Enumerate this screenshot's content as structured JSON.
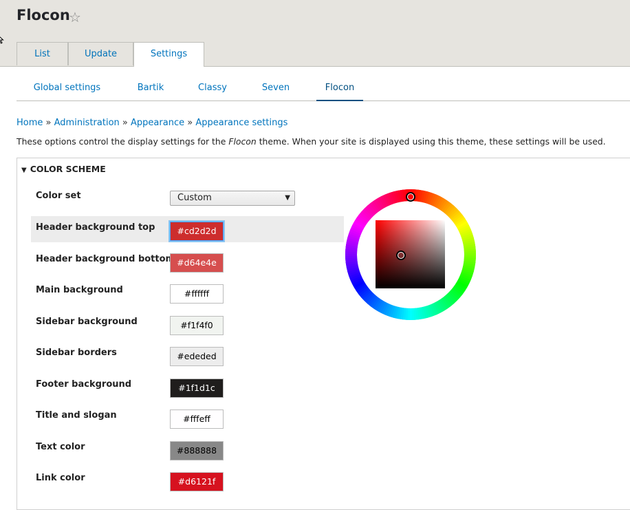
{
  "page": {
    "title": "Flocon",
    "icons": {
      "favorite": "star-icon",
      "cursor": "mouse-cursor-icon",
      "expand": "triangle-down-icon"
    }
  },
  "tabs": [
    {
      "label": "List",
      "active": false
    },
    {
      "label": "Update",
      "active": false
    },
    {
      "label": "Settings",
      "active": true
    }
  ],
  "subtabs": [
    {
      "label": "Global settings",
      "active": false
    },
    {
      "label": "Bartik",
      "active": false
    },
    {
      "label": "Classy",
      "active": false
    },
    {
      "label": "Seven",
      "active": false
    },
    {
      "label": "Flocon",
      "active": true
    }
  ],
  "breadcrumb": {
    "items": [
      "Home",
      "Administration",
      "Appearance",
      "Appearance settings"
    ],
    "separator": "»"
  },
  "description": {
    "before": "These options control the display settings for the ",
    "theme": "Flocon",
    "after": " theme. When your site is displayed using this theme, these settings will be used."
  },
  "color_scheme": {
    "legend": "COLOR SCHEME",
    "color_set": {
      "label": "Color set",
      "value": "Custom"
    },
    "fields": [
      {
        "label": "Header background top",
        "value": "#cd2d2d",
        "bg": "#cd2d2d",
        "fg": "#ffffff",
        "focused": true
      },
      {
        "label": "Header background bottom",
        "value": "#d64e4e",
        "bg": "#d64e4e",
        "fg": "#ffffff",
        "focused": false
      },
      {
        "label": "Main background",
        "value": "#ffffff",
        "bg": "#ffffff",
        "fg": "#000000",
        "focused": false
      },
      {
        "label": "Sidebar background",
        "value": "#f1f4f0",
        "bg": "#f1f4f0",
        "fg": "#000000",
        "focused": false
      },
      {
        "label": "Sidebar borders",
        "value": "#ededed",
        "bg": "#ededed",
        "fg": "#000000",
        "focused": false
      },
      {
        "label": "Footer background",
        "value": "#1f1d1c",
        "bg": "#1f1d1c",
        "fg": "#ffffff",
        "focused": false
      },
      {
        "label": "Title and slogan",
        "value": "#fffeff",
        "bg": "#fffeff",
        "fg": "#000000",
        "focused": false
      },
      {
        "label": "Text color",
        "value": "#888888",
        "bg": "#888888",
        "fg": "#000000",
        "focused": false
      },
      {
        "label": "Link color",
        "value": "#d6121f",
        "bg": "#d6121f",
        "fg": "#ffffff",
        "focused": false
      }
    ]
  },
  "color_picker": {
    "hue": "#ff0000"
  },
  "colors": {
    "link": "#0074bd",
    "header_bg": "#e6e4df"
  }
}
